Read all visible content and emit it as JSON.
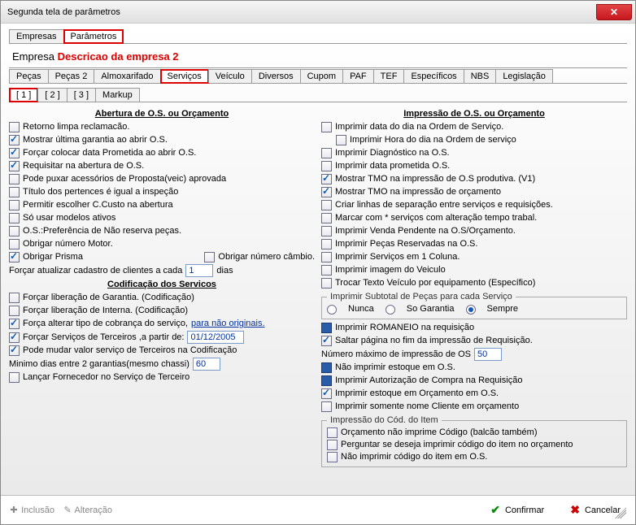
{
  "window": {
    "title": "Segunda tela de parâmetros"
  },
  "topTabs": {
    "empresas": "Empresas",
    "parametros": "Parâmetros"
  },
  "empresa": {
    "label": "Empresa",
    "desc": "Descricao da empresa 2"
  },
  "catTabs": {
    "pecas": "Peças",
    "pecas2": "Peças 2",
    "almox": "Almoxarifado",
    "servicos": "Serviços",
    "veic": "Veículo",
    "diversos": "Diversos",
    "cupom": "Cupom",
    "paf": "PAF",
    "tef": "TEF",
    "especificos": "Específicos",
    "nbs": "NBS",
    "legislacao": "Legislação"
  },
  "subTabs": {
    "t1": "[ 1 ]",
    "t2": "[ 2 ]",
    "t3": "[ 3 ]",
    "markup": "Markup"
  },
  "left": {
    "sec1": "Abertura de O.S. ou Orçamento",
    "retorno": "Retorno limpa reclamacão.",
    "mostrarUltGar": "Mostrar última garantia ao abrir O.S.",
    "forcarData": "Forçar colocar data Prometida ao abrir O.S.",
    "requisitar": "Requisitar na abertura de O.S.",
    "podePuxar": "Pode puxar acessórios de Proposta(veic) aprovada",
    "tituloPert": "Título dos pertences é igual a inspeção",
    "permitirCCusto": "Permitir escolher C.Custo na abertura",
    "soModelos": "Só usar modelos ativos",
    "osPref": "O.S.:Preferência de Não reserva peças.",
    "obrigarMotor": "Obrigar número Motor.",
    "obrigarPrisma": "Obrigar Prisma",
    "obrigarCambio": "Obrigar número câmbio.",
    "forcarCadastro": "Forçar atualizar cadastro de clientes a cada",
    "forcarCadastroVal": "1",
    "dias": "dias",
    "sec2": "Codificação dos Servicos",
    "forcarLibGar": "Forçar liberação de Garantia. (Codificação)",
    "forcarLibInt": "Forçar liberação de Interna. (Codificação)",
    "forcaAlterar": "Força alterar tipo de cobrança do serviço,",
    "forcaAlterarLink": "para não originais.",
    "forcarTerc": "Forçar Serviços de Terceiros ,a partir de:",
    "forcarTercDate": "01/12/2005",
    "podeMudar": "Pode mudar valor serviço de Terceiros na Codificação",
    "minimoDias": "Minimo dias entre 2 garantias(mesmo chassi)",
    "minimoDiasVal": "60",
    "lancarForn": "Lançar Fornecedor no Serviço de Terceiro"
  },
  "right": {
    "sec1": "Impressão de O.S. ou Orçamento",
    "impDataDia": "Imprimir data do dia na Ordem de Serviço.",
    "impHoraDia": "Imprimir Hora do dia na Ordem de serviço",
    "impDiag": "Imprimir Diagnóstico na O.S.",
    "impDataProm": "Imprimir data prometida O.S.",
    "mostrarTMOprod": "Mostrar TMO na impressão de O.S produtiva. (V1)",
    "mostrarTMOorc": "Mostrar TMO na impressão de orçamento",
    "criarLinhas": "Criar linhas de separação entre serviços e requisições.",
    "marcarAst": "Marcar com * serviços com alteração tempo trabal.",
    "impVenda": "Imprimir Venda Pendente na O.S/Orçamento.",
    "impPecasRes": "Imprimir Peças Reservadas na O.S.",
    "impServ1Col": "Imprimir Serviços em 1 Coluna.",
    "impImgVeic": "Imprimir imagem do Veiculo",
    "trocarTexto": "Trocar Texto Veículo por equipamento (Específico)",
    "grpSubtotal": "Imprimir Subtotal de Peças para cada Serviço",
    "radNunca": "Nunca",
    "radSoGar": "So Garantia",
    "radSempre": "Sempre",
    "impRomaneio": "Imprimir ROMANEIO na requisição",
    "saltarPag": "Saltar página no fim da impressão de Requisição.",
    "numMax": "Número máximo de impressão de OS",
    "numMaxVal": "50",
    "naoImpEstOS": "Não imprimir estoque em O.S.",
    "impAutCompra": "Imprimir Autorização de Compra na Requisição",
    "impEstOrc": "Imprimir estoque em Orçamento em O.S.",
    "impSomenteNome": "Imprimir somente nome Cliente em orçamento",
    "grpCodItem": "Impressão do Cód. do Item",
    "orcNaoImp": "Orçamento não imprime Código (balcão também)",
    "perguntar": "Perguntar se deseja imprimir código do item no orçamento",
    "naoImpCodOS": "Não imprimir código do item em O.S."
  },
  "footer": {
    "inclusao": "Inclusão",
    "alteracao": "Alteração",
    "confirmar": "Confirmar",
    "cancelar": "Cancelar"
  }
}
